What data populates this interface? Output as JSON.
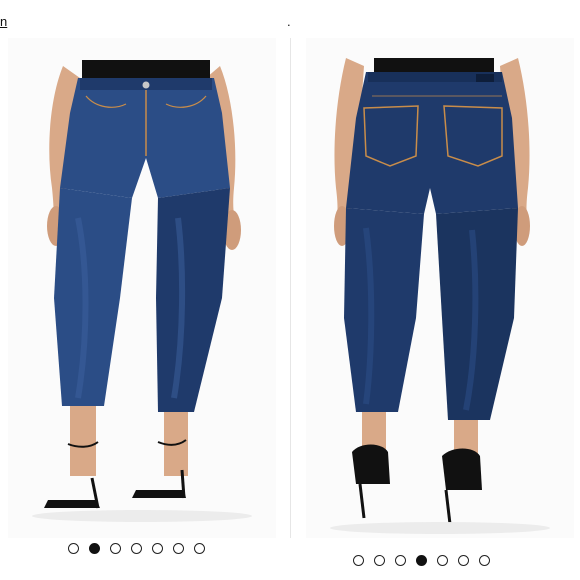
{
  "header": {
    "left_text": "n",
    "right_text": "."
  },
  "gallery_left": {
    "view": "front",
    "dot_count": 7,
    "active_index": 1
  },
  "gallery_right": {
    "view": "back",
    "dot_count": 7,
    "active_index": 3
  },
  "colors": {
    "denim_dark": "#1f3a6b",
    "denim_mid": "#2b4d86",
    "skin": "#d9a988",
    "top_black": "#111111",
    "heel_black": "#111111",
    "stitch": "#c98d4a"
  }
}
